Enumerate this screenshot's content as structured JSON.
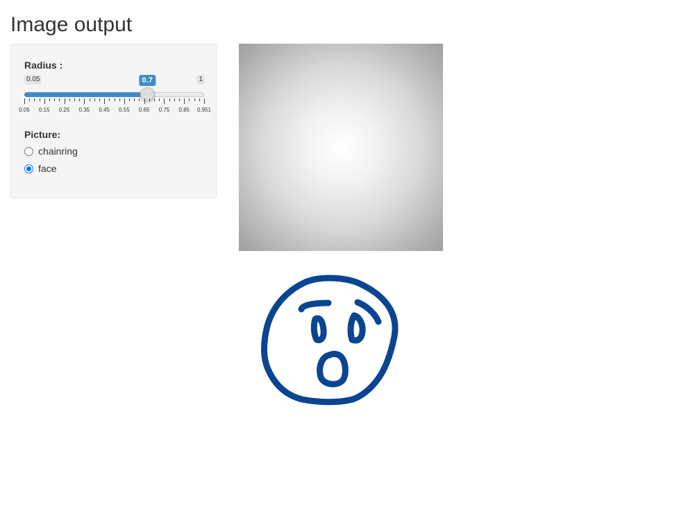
{
  "page": {
    "title": "Image output"
  },
  "controls": {
    "radius": {
      "label": "Radius :",
      "min": 0.05,
      "max": 1,
      "value": 0.7,
      "min_label": "0.05",
      "max_label": "1",
      "value_label": "0.7",
      "tick_labels": [
        "0.05",
        "0.15",
        "0.25",
        "0.35",
        "0.45",
        "0.55",
        "0.65",
        "0.75",
        "0.85",
        "0.951"
      ]
    },
    "picture": {
      "label": "Picture:",
      "options": [
        {
          "label": "chainring",
          "checked": false
        },
        {
          "label": "face",
          "checked": true
        }
      ]
    }
  },
  "colors": {
    "slider_accent": "#428bca",
    "radio_accent": "#0075ff",
    "face_stroke": "#0a4592"
  },
  "images": {
    "top": "radial-gradient",
    "bottom": "face-drawing"
  }
}
